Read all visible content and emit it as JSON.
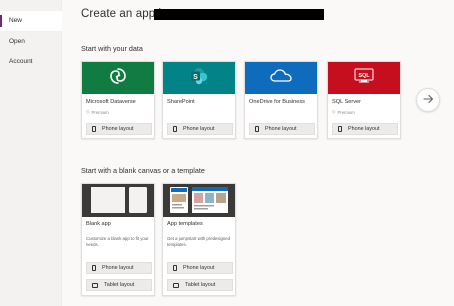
{
  "sidebar": {
    "items": [
      {
        "label": "New",
        "active": true
      },
      {
        "label": "Open",
        "active": false
      },
      {
        "label": "Account",
        "active": false
      }
    ]
  },
  "main": {
    "title": "Create an app in",
    "sections": {
      "data": "Start with your data",
      "blank": "Start with a blank canvas or a template"
    },
    "data_cards": [
      {
        "title": "Microsoft Dataverse",
        "sub": "Premium",
        "hero_color": "#107c41",
        "icon": "dataverse-icon",
        "button": "Phone layout"
      },
      {
        "title": "SharePoint",
        "sub": "",
        "hero_color": "#038387",
        "icon": "sharepoint-icon",
        "button": "Phone layout"
      },
      {
        "title": "OneDrive for Business",
        "sub": "",
        "hero_color": "#0f6cbd",
        "icon": "onedrive-icon",
        "button": "Phone layout"
      },
      {
        "title": "SQL Server",
        "sub": "Premium",
        "hero_color": "#c50f1f",
        "icon": "sql-server-icon",
        "icon_text": "SQL",
        "button": "Phone layout"
      }
    ],
    "template_cards": [
      {
        "title": "Blank app",
        "desc": "Customize a blank app to fit your needs.",
        "phone": "Phone layout",
        "tablet": "Tablet layout"
      },
      {
        "title": "App templates",
        "desc": "Get a jumpstart with predesigned templates.",
        "phone": "Phone layout",
        "tablet": "Tablet layout"
      }
    ]
  }
}
